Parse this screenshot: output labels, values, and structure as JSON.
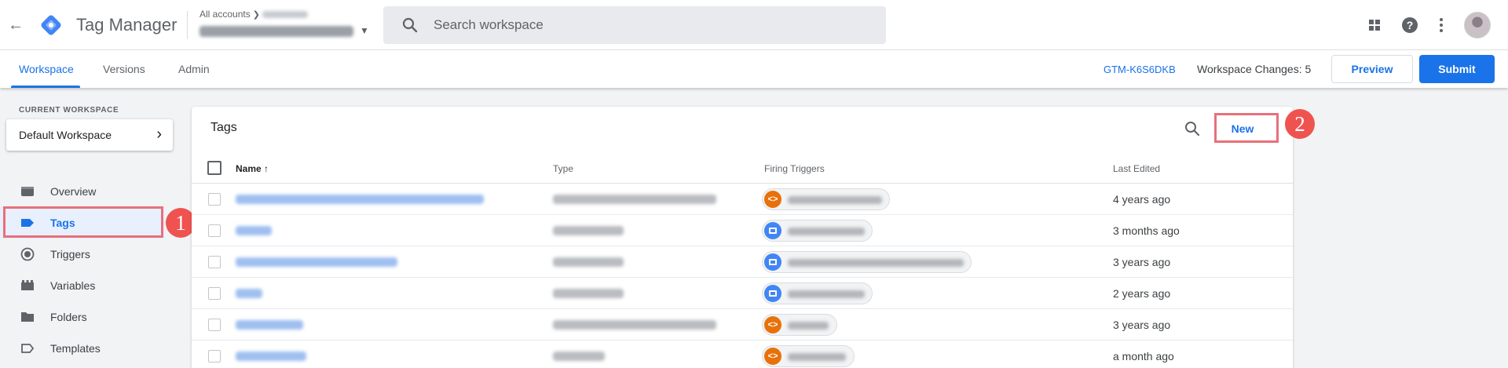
{
  "topbar": {
    "app_title": "Tag Manager",
    "account_crumb": "All accounts",
    "search_placeholder": "Search workspace"
  },
  "subnav": {
    "tabs": [
      {
        "label": "Workspace",
        "active": true
      },
      {
        "label": "Versions",
        "active": false
      },
      {
        "label": "Admin",
        "active": false
      }
    ],
    "container_id": "GTM-K6S6DKB",
    "workspace_changes": "Workspace Changes: 5",
    "preview_label": "Preview",
    "submit_label": "Submit"
  },
  "sidebar": {
    "current_workspace_label": "CURRENT WORKSPACE",
    "workspace_name": "Default Workspace",
    "items": [
      {
        "label": "Overview",
        "icon": "overview-icon",
        "active": false
      },
      {
        "label": "Tags",
        "icon": "tag-icon",
        "active": true
      },
      {
        "label": "Triggers",
        "icon": "trigger-icon",
        "active": false
      },
      {
        "label": "Variables",
        "icon": "variables-icon",
        "active": false
      },
      {
        "label": "Folders",
        "icon": "folder-icon",
        "active": false
      },
      {
        "label": "Templates",
        "icon": "templates-icon",
        "active": false
      }
    ]
  },
  "annotations": {
    "step1": "1",
    "step2": "2",
    "highlight_color": "#e8707a"
  },
  "tags_panel": {
    "title": "Tags",
    "new_label": "New",
    "columns": {
      "name": "Name",
      "type": "Type",
      "firing_triggers": "Firing Triggers",
      "last_edited": "Last Edited"
    },
    "rows": [
      {
        "last_edited": "4 years ago",
        "trigger_icon": "orange"
      },
      {
        "last_edited": "3 months ago",
        "trigger_icon": "blue"
      },
      {
        "last_edited": "3 years ago",
        "trigger_icon": "blue"
      },
      {
        "last_edited": "2 years ago",
        "trigger_icon": "blue"
      },
      {
        "last_edited": "3 years ago",
        "trigger_icon": "orange"
      },
      {
        "last_edited": "a month ago",
        "trigger_icon": "orange"
      }
    ]
  },
  "colors": {
    "accent": "#1a73e8",
    "custom_event_trigger": "#e8710a",
    "page_trigger": "#4285f4"
  }
}
